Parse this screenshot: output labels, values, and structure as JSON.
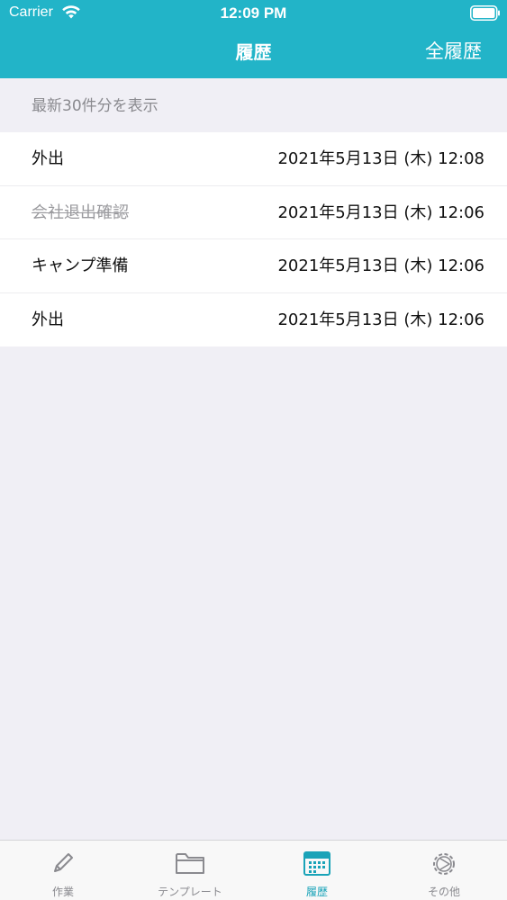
{
  "status_bar": {
    "carrier": "Carrier",
    "time": "12:09 PM",
    "wifi_icon": "wifi-icon",
    "battery_icon": "battery-icon"
  },
  "nav": {
    "title": "履歴",
    "right_button": "全履歴"
  },
  "section": {
    "header": "最新30件分を表示"
  },
  "rows": [
    {
      "title": "外出",
      "date": "2021年5月13日 (木) 12:08",
      "done": false
    },
    {
      "title": "会社退出確認",
      "date": "2021年5月13日 (木) 12:06",
      "done": true
    },
    {
      "title": "キャンプ準備",
      "date": "2021年5月13日 (木) 12:06",
      "done": false
    },
    {
      "title": "外出",
      "date": "2021年5月13日 (木) 12:06",
      "done": false
    }
  ],
  "tabs": [
    {
      "label": "作業",
      "icon": "pencil-icon",
      "active": false
    },
    {
      "label": "テンプレート",
      "icon": "folder-icon",
      "active": false
    },
    {
      "label": "履歴",
      "icon": "calendar-icon",
      "active": true
    },
    {
      "label": "その他",
      "icon": "gear-icon",
      "active": false
    }
  ],
  "colors": {
    "accent": "#22b4c8",
    "tab_active": "#1aa3b8",
    "tab_inactive": "#8a8a8f",
    "background": "#f0eff5"
  }
}
